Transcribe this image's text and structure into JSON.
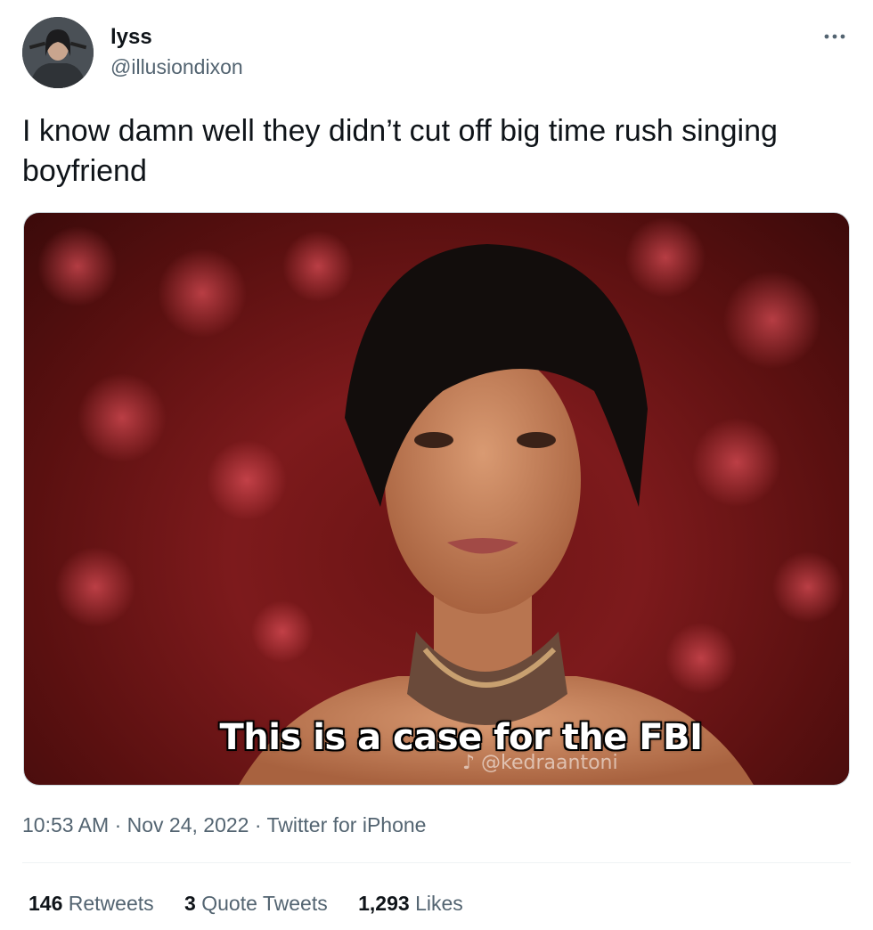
{
  "author": {
    "display_name": "lyss",
    "handle": "@illusiondixon"
  },
  "tweet": {
    "text": "I know damn well they didn’t cut off big time rush singing boyfriend"
  },
  "media": {
    "caption": "This is a case for the FBI",
    "watermark": "♪ @kedraantoni"
  },
  "meta": {
    "time": "10:53 AM",
    "separator": " · ",
    "date": "Nov 24, 2022",
    "source": "Twitter for iPhone"
  },
  "stats": {
    "retweets_count": "146",
    "retweets_label": "Retweets",
    "quotes_count": "3",
    "quotes_label": "Quote Tweets",
    "likes_count": "1,293",
    "likes_label": "Likes"
  },
  "colors": {
    "text_primary": "#0f1419",
    "text_secondary": "#536471",
    "divider": "#eff3f4"
  },
  "icons": {
    "more": "more-horizontal-icon"
  }
}
